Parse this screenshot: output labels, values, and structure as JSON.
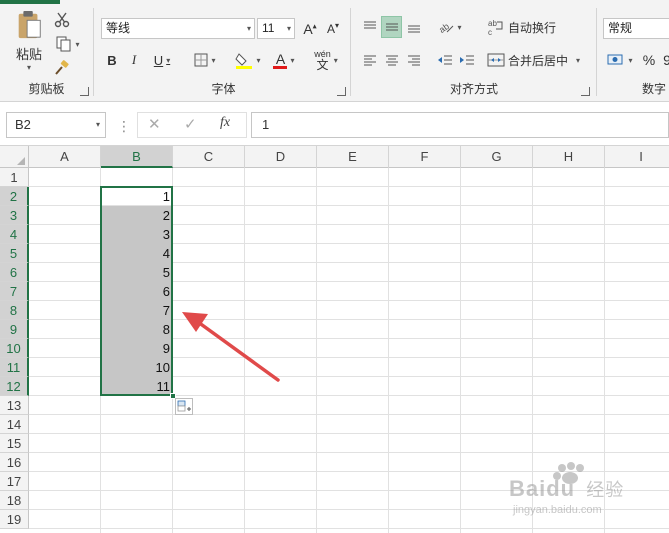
{
  "ribbon": {
    "clipboard": {
      "paste_label": "粘贴",
      "group_label": "剪贴板"
    },
    "font": {
      "font_name": "等线",
      "font_size": "11",
      "bold": "B",
      "italic": "I",
      "underline": "U",
      "font_color_letter": "A",
      "phonetic_top": "wén",
      "phonetic_bottom": "文",
      "group_label": "字体",
      "highlight_color": "#ffff00",
      "font_color": "#e01919"
    },
    "alignment": {
      "wrap_text_label": "自动换行",
      "merge_center_label": "合并后居中",
      "group_label": "对齐方式"
    },
    "number": {
      "format_value": "常规",
      "percent_label": "%",
      "comma_label": "9",
      "group_label": "数字"
    }
  },
  "formula_bar": {
    "name_box": "B2",
    "fx_label": "fx",
    "value": "1"
  },
  "sheet": {
    "columns": [
      "A",
      "B",
      "C",
      "D",
      "E",
      "F",
      "G",
      "H",
      "I"
    ],
    "rows": [
      "1",
      "2",
      "3",
      "4",
      "5",
      "6",
      "7",
      "8",
      "9",
      "10",
      "11",
      "12",
      "13",
      "14",
      "15",
      "16",
      "17",
      "18",
      "19"
    ],
    "column_b_values": [
      "1",
      "2",
      "3",
      "4",
      "5",
      "6",
      "7",
      "8",
      "9",
      "10",
      "11"
    ],
    "selected_column": "B",
    "selected_rows": [
      "2",
      "3",
      "4",
      "5",
      "6",
      "7",
      "8",
      "9",
      "10",
      "11",
      "12"
    ]
  },
  "colors": {
    "accent": "#217346",
    "annotation_arrow": "#e04a4a"
  },
  "watermark": {
    "brand": "Baidu",
    "subtitle": "经验",
    "url": "jingyan.baidu.com"
  }
}
